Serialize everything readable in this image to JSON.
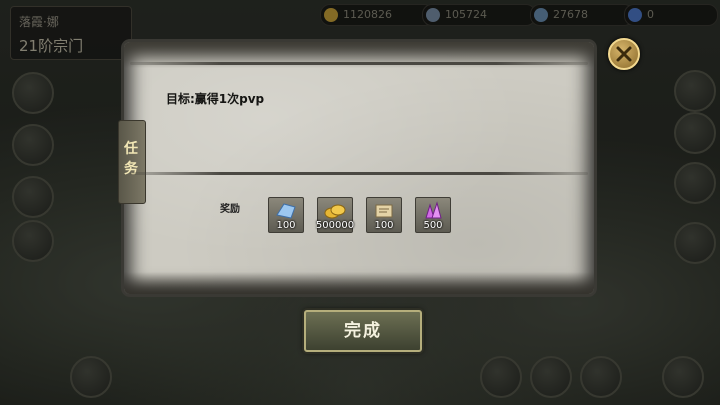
{
  "top_left": {
    "line1": "落霞·娜",
    "line2": "21阶宗门"
  },
  "resources": [
    {
      "value": "1120826",
      "color": "#c9a33a"
    },
    {
      "value": "105724",
      "color": "#7a8fa8"
    },
    {
      "value": "27678",
      "color": "#6b8fb3"
    },
    {
      "value": "0",
      "color": "#4d79c9"
    }
  ],
  "dialog": {
    "objective": "目标:赢得1次pvp",
    "tab_label": "任务",
    "reward_label": "奖励",
    "rewards": [
      {
        "icon": "blue-crystal-icon",
        "qty": "100",
        "color": "#8fb9e6"
      },
      {
        "icon": "gold-ingot-icon",
        "qty": "500000",
        "color": "#e0b635"
      },
      {
        "icon": "scroll-icon",
        "qty": "100",
        "color": "#c9b487"
      },
      {
        "icon": "purple-crystal-icon",
        "qty": "500",
        "color": "#c55ad8"
      }
    ],
    "complete_label": "完成",
    "close_icon": "close-icon"
  },
  "colors": {
    "accent_gold": "#e2c56f",
    "button_green": "#4d5140",
    "parchment": "#cdcbc2"
  }
}
